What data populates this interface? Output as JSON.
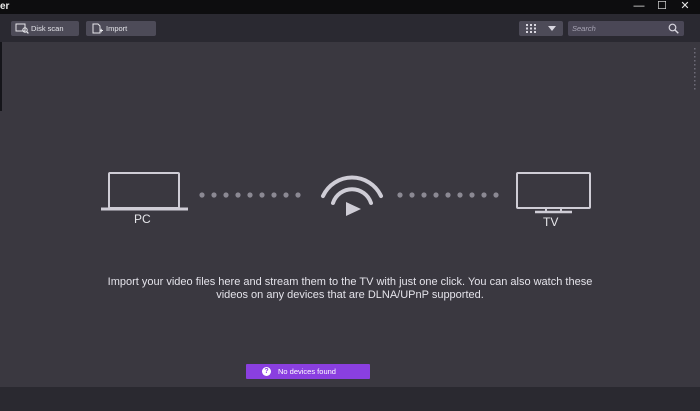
{
  "window": {
    "title": "er",
    "minimize_glyph": "—",
    "maximize_glyph": "☐",
    "close_glyph": "✕"
  },
  "toolbar": {
    "disk_scan_label": "Disk scan",
    "import_label": "Import",
    "search_placeholder": "Search",
    "search_value": ""
  },
  "stream": {
    "pc_label": "PC",
    "tv_label": "TV",
    "message_line1": "Import your video files here and stream them to the TV with just one click. You can also watch these",
    "message_line2": "videos on any devices that are DLNA/UPnP supported.",
    "status_label": "No devices found",
    "status_icon_glyph": "?"
  },
  "colors": {
    "background": "#3a3840",
    "toolbar": "#2a2931",
    "accent_purple": "#8a3fe0",
    "search_bg": "#4a4756",
    "icon_light": "#cfcdd6"
  },
  "icons": {
    "disk_scan": "disk-scan-icon",
    "import": "import-icon",
    "view_grid": "grid-view-icon",
    "dropdown": "caret-down-icon",
    "search": "search-icon",
    "pc": "laptop-icon",
    "wifi": "wifi-stream-icon",
    "tv": "tv-icon",
    "help": "question-icon"
  }
}
